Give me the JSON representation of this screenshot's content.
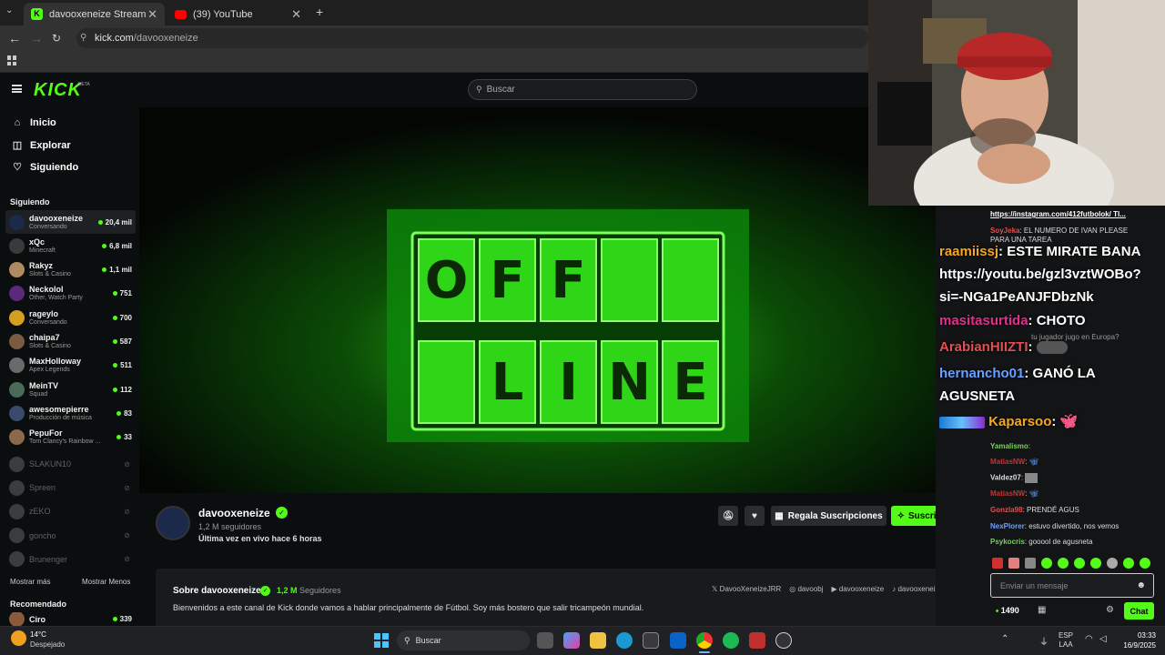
{
  "browser": {
    "tabs": [
      {
        "title": "davooxeneize Stream - Watch L",
        "active": true
      },
      {
        "title": "(39) YouTube",
        "active": false
      }
    ],
    "url_host": "kick.com",
    "url_path": "/davooxeneize"
  },
  "header": {
    "logo": "KICK",
    "beta": "BETA",
    "search_placeholder": "Buscar"
  },
  "sidebar": {
    "nav": [
      {
        "label": "Inicio",
        "icon": "home-icon"
      },
      {
        "label": "Explorar",
        "icon": "compass-icon"
      },
      {
        "label": "Siguiendo",
        "icon": "heart-icon"
      }
    ],
    "following_title": "Siguiendo",
    "channels": [
      {
        "name": "davooxeneize",
        "sub": "Conversando",
        "viewers": "20,4 mil",
        "color": "#1b2a4a"
      },
      {
        "name": "xQc",
        "sub": "Minecraft",
        "viewers": "6,8 mil",
        "color": "#3a3a3a"
      },
      {
        "name": "Rakyz",
        "sub": "Slots & Casino",
        "viewers": "1,1 mil",
        "color": "#b08a60"
      },
      {
        "name": "Neckolol",
        "sub": "Other, Watch Party",
        "viewers": "751",
        "color": "#5a2a7a"
      },
      {
        "name": "rageylo",
        "sub": "Conversando",
        "viewers": "700",
        "color": "#d4a020"
      },
      {
        "name": "chaipa7",
        "sub": "Slots & Casino",
        "viewers": "587",
        "color": "#7a5a40"
      },
      {
        "name": "MaxHolloway",
        "sub": "Apex Legends",
        "viewers": "511",
        "color": "#6a6a6a"
      },
      {
        "name": "MeinTV",
        "sub": "Squad",
        "viewers": "112",
        "color": "#4a6a5a"
      },
      {
        "name": "awesomepierre",
        "sub": "Producción de música",
        "viewers": "83",
        "color": "#3a4a6a"
      },
      {
        "name": "PepuFor",
        "sub": "Tom Clancy's Rainbow ...",
        "viewers": "33",
        "color": "#8a6a4a"
      }
    ],
    "offline": [
      "SLAKUN10",
      "Spreen",
      "zEKO",
      "goncho",
      "Brunenger"
    ],
    "show_more": "Mostrar más",
    "show_less": "Mostrar Menos",
    "recommended_title": "Recomendado",
    "recommended": {
      "name": "Ciro",
      "viewers": "339"
    }
  },
  "player": {
    "line1": [
      "O",
      "F",
      "F",
      "",
      ""
    ],
    "line2": [
      "",
      "L",
      "I",
      "N",
      "E"
    ]
  },
  "channel": {
    "name": "davooxeneize",
    "followers": "1,2 M seguidores",
    "last_live": "Última vez en vivo hace 6 horas",
    "gift_label": "Regala Suscripciones",
    "subscribe_label": "Suscribirse",
    "about_title": "Sobre davooxeneize",
    "about_followers_num": "1,2 M",
    "about_followers_label": "Seguidores",
    "bio": "Bienvenidos a este canal de Kick donde vamos a hablar principalmente de Fútbol. Soy más bostero que salir tricampeón mundial.",
    "socials": [
      {
        "icon": "x-icon",
        "label": "DavooXeneizeJRR"
      },
      {
        "icon": "instagram-icon",
        "label": "davoobj"
      },
      {
        "icon": "youtube-icon",
        "label": "davooxeneize"
      },
      {
        "icon": "tiktok-icon",
        "label": "davooxeneize"
      }
    ]
  },
  "chat": {
    "top_link": "https://instagram.com/412futbolok/ Tl...",
    "small_msgs": [
      {
        "user": "SoyJeka",
        "text": "EL NUMERO DE IVAN PLEASE PARA UNA TAREA",
        "color": "#e05050"
      },
      {
        "user": "",
        "text": "tu jugador jugo en Europa?",
        "color": "#ddd"
      }
    ],
    "big_msgs": [
      {
        "user": "raamiissj",
        "text": ": ESTE MIRATE BANA https://youtu.be/gzl3vztWOBo?si=-NGa1PeANJFDbzNk",
        "color": "#f5a623"
      },
      {
        "user": "masitasurtida",
        "text": ": CHOTO",
        "color": "#e0308a"
      },
      {
        "user": "ArabianHIIZTI",
        "text": ":",
        "color": "#e05050"
      },
      {
        "user": "hernancho01",
        "text": ": GANÓ LA AGUSNETA",
        "color": "#6aa0ff"
      },
      {
        "user": "Kaparsoo",
        "text": ":",
        "color": "#f5a623"
      }
    ],
    "bottom_msgs": [
      {
        "user": "Yamalismo",
        "text": ":",
        "color": "#7ad060"
      },
      {
        "user": "MatiasNW",
        "text": ":",
        "color": "#d03030"
      },
      {
        "user": "Valdez07",
        "text": ":",
        "color": "#ddd"
      },
      {
        "user": "MatiasNW",
        "text": ":",
        "color": "#d03030"
      },
      {
        "user": "Gonzla98",
        "text": ": PRENDÉ AGUS",
        "color": "#e05050"
      },
      {
        "user": "NexPlorer",
        "text": ": estuvo divertido, nos vemos",
        "color": "#6aa0ff"
      },
      {
        "user": "Psykocris",
        "text": ": gooool de agusneta",
        "color": "#7ad060"
      }
    ],
    "input_placeholder": "Enviar un mensaje",
    "points": "1490",
    "chat_button": "Chat"
  },
  "taskbar": {
    "weather_temp": "14°C",
    "weather_desc": "Despejado",
    "search": "Buscar",
    "lang1": "ESP",
    "lang2": "LAA",
    "time": "03:33",
    "date": "16/9/2025"
  }
}
